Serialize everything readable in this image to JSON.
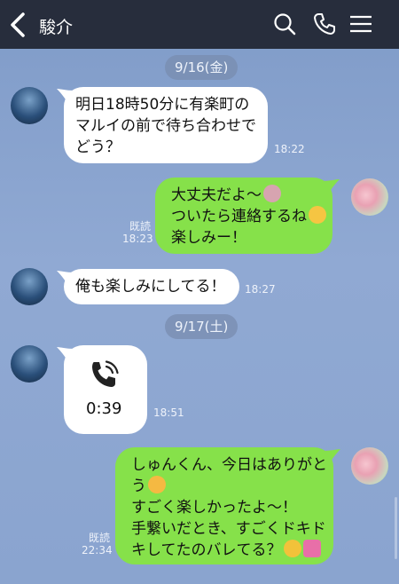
{
  "header": {
    "title": "駿介"
  },
  "dates": [
    "9/16(金)",
    "9/17(土)"
  ],
  "messages": [
    {
      "text1": "明日18時50分に有楽町の",
      "text2": "マルイの前で待ち合わせで",
      "text3": "どう？",
      "time": "18:22"
    },
    {
      "text1": "大丈夫だよ〜",
      "text2": "ついたら連絡するね",
      "text3": "楽しみー！",
      "time": "18:23",
      "read": "既読"
    },
    {
      "text1": "俺も楽しみにしてる！",
      "time": "18:27"
    },
    {
      "call_duration": "0:39",
      "time": "18:51"
    },
    {
      "text1": "しゅんくん、今日はありがと",
      "text2": "う",
      "text3": "すごく楽しかったよ〜！",
      "text4": "手繋いだとき、すごくドキド",
      "text5": "キしてたのバレてる？",
      "time": "22:34",
      "read": "既読"
    }
  ],
  "colors": {
    "header_bg": "#272d3c",
    "bubble_green": "#86e14a",
    "bubble_white": "#ffffff",
    "chat_bg": "#8aa4cf"
  },
  "icons": [
    "back-chevron",
    "search",
    "phone",
    "menu",
    "phone-call"
  ]
}
